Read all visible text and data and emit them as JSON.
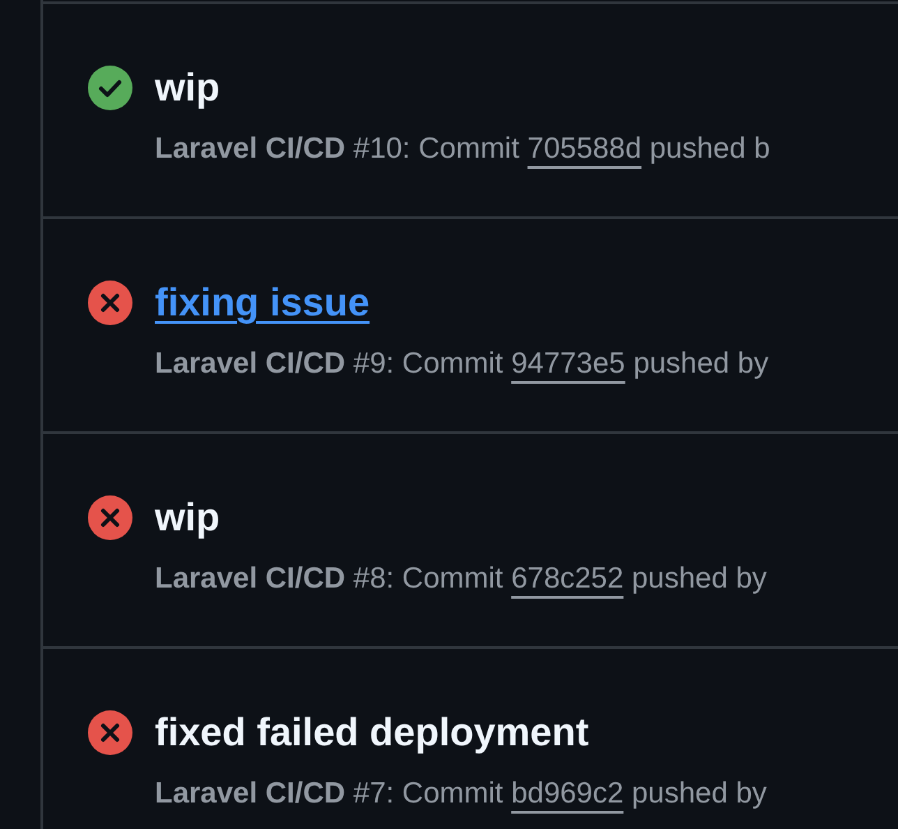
{
  "runs": [
    {
      "kind": "success",
      "title": "wip",
      "hovered": false,
      "prefix": "**Laravel CI/CD** #10: Commit ",
      "commit": "705588d",
      "suffix": "pushed b"
    },
    {
      "kind": "failure",
      "title": "fixing issue",
      "hovered": true,
      "prefix": "**Laravel CI/CD** #9: Commit ",
      "commit": "94773e5",
      "suffix": "pushed by"
    },
    {
      "kind": "failure",
      "title": "wip",
      "hovered": false,
      "prefix": "**Laravel CI/CD** #8: Commit ",
      "commit": "678c252",
      "suffix": "pushed by"
    },
    {
      "kind": "failure",
      "title": "fixed failed deployment",
      "hovered": false,
      "prefix": "**Laravel CI/CD** #7: Commit ",
      "commit": "bd969c2",
      "suffix": "pushed by"
    }
  ]
}
